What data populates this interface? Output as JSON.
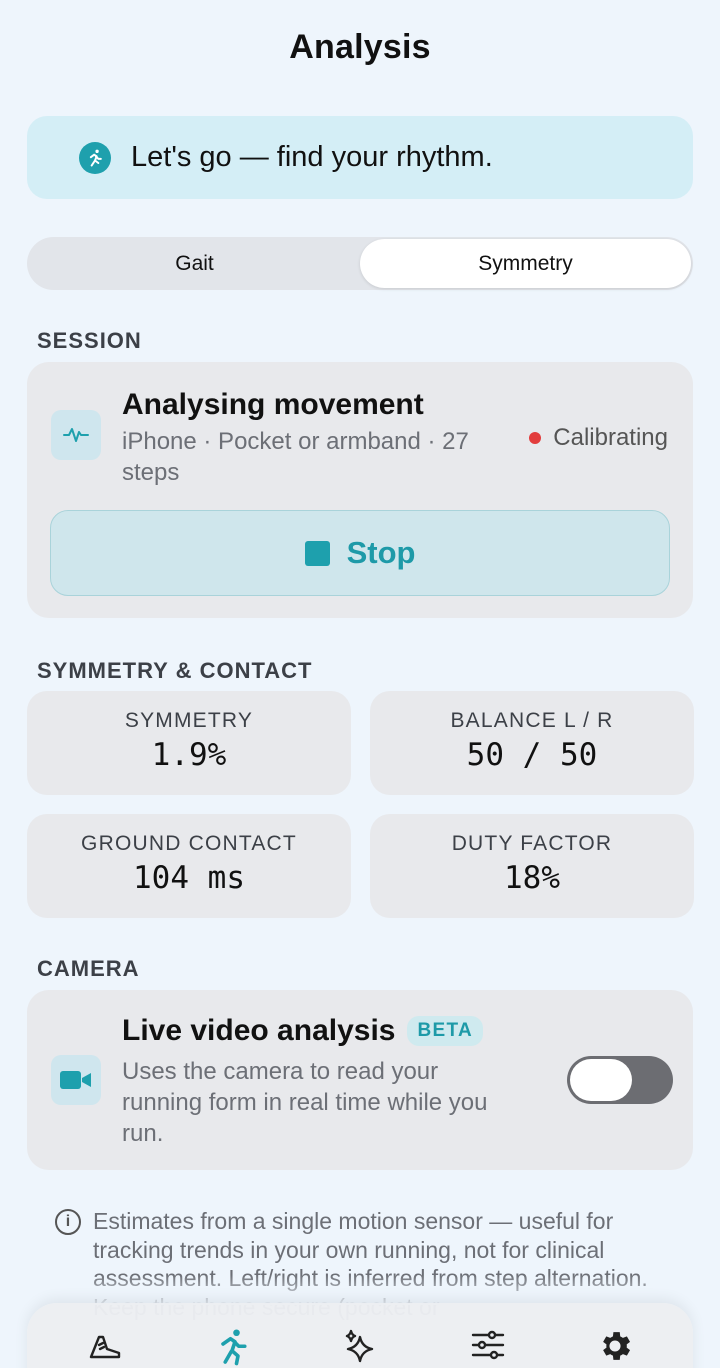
{
  "header": {
    "title": "Analysis"
  },
  "banner": {
    "text": "Let's go — find your rhythm.",
    "icon": "runner-icon"
  },
  "segmented": {
    "tabs": [
      "Gait",
      "Symmetry"
    ],
    "selected": "Symmetry"
  },
  "session": {
    "section_label": "SESSION",
    "title": "Analysing movement",
    "subtitle": "iPhone · Pocket or armband · 27 steps",
    "status": "Calibrating",
    "status_color": "#e23d3d",
    "stop_label": "Stop",
    "icon": "pulse-icon"
  },
  "symmetry": {
    "section_label": "SYMMETRY & CONTACT",
    "metrics": [
      {
        "label": "SYMMETRY",
        "value": "1.9%"
      },
      {
        "label": "BALANCE L / R",
        "value": "50 / 50"
      },
      {
        "label": "GROUND CONTACT",
        "value": "104 ms"
      },
      {
        "label": "DUTY FACTOR",
        "value": "18%"
      }
    ]
  },
  "camera": {
    "section_label": "CAMERA",
    "title": "Live video analysis",
    "badge": "BETA",
    "description": "Uses the camera to read your running form in real time while you run.",
    "toggle_on": false,
    "icon": "video-camera-icon"
  },
  "note": {
    "text": "Estimates from a single motion sensor — useful for tracking trends in your own running, not for clinical assessment. Left/right is inferred from step alternation. Keep the phone secure (pocket or"
  },
  "tabbar": {
    "items": [
      "shoe-icon",
      "runner-icon",
      "sparkle-icon",
      "sliders-icon",
      "gear-icon"
    ],
    "active": "runner-icon"
  },
  "colors": {
    "accent": "#1ea0ad",
    "background": "#eef5fc",
    "card": "#e8e9ec"
  }
}
